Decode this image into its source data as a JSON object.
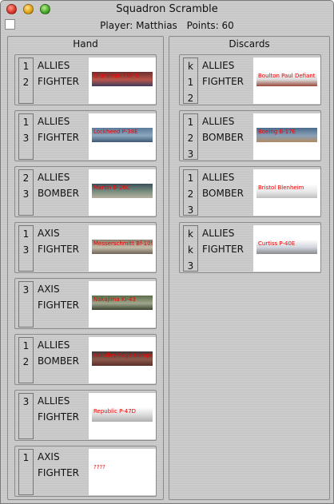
{
  "window": {
    "title": "Squadron Scramble"
  },
  "status": {
    "player": "Player: Matthias",
    "points": "Points: 60"
  },
  "hand": {
    "title": "Hand",
    "cards": [
      {
        "c1": "1",
        "c2": "2",
        "c3": "",
        "side": "ALLIES",
        "type": "FIGHTER",
        "plane": "Grumman F6F-5",
        "colors": [
          "#6b2e2e",
          "#b8544a",
          "#3c3c5c"
        ]
      },
      {
        "c1": "1",
        "c2": "3",
        "c3": "",
        "side": "ALLIES",
        "type": "FIGHTER",
        "plane": "Lockheed P-38E",
        "colors": [
          "#5b7a9a",
          "#8ba6bf",
          "#3e5872"
        ]
      },
      {
        "c1": "2",
        "c2": "3",
        "c3": "",
        "side": "ALLIES",
        "type": "BOMBER",
        "plane": "Martin B-26C",
        "colors": [
          "#3b4f5c",
          "#7b8f80",
          "#b8b0a0"
        ]
      },
      {
        "c1": "1",
        "c2": "3",
        "c3": "",
        "side": "AXIS",
        "type": "FIGHTER",
        "plane": "Messerschmitt Bf-109E",
        "colors": [
          "#8a8070",
          "#c4bba8",
          "#6e6456"
        ]
      },
      {
        "c1": "3",
        "c2": "",
        "c3": "",
        "side": "AXIS",
        "type": "FIGHTER",
        "plane": "Nakajima Ki-43",
        "colors": [
          "#5a6e4a",
          "#a0a68c",
          "#3a4430"
        ]
      },
      {
        "c1": "1",
        "c2": "2",
        "c3": "",
        "side": "ALLIES",
        "type": "BOMBER",
        "plane": "Handley Page Hampden",
        "colors": [
          "#3e3838",
          "#8c5a4a",
          "#5a2e2a"
        ]
      },
      {
        "c1": "3",
        "c2": "",
        "c3": "",
        "side": "ALLIES",
        "type": "FIGHTER",
        "plane": "Republic P-47D",
        "colors": [
          "#ffffff",
          "#d8d8d8",
          "#b0b0b0"
        ]
      },
      {
        "c1": "1",
        "c2": "",
        "c3": "",
        "side": "AXIS",
        "type": "FIGHTER",
        "plane": "????",
        "colors": [
          "#ffffff",
          "#ffffff",
          "#ffffff"
        ]
      }
    ]
  },
  "discards": {
    "title": "Discards",
    "cards": [
      {
        "c1": "k",
        "c2": "1",
        "c3": "2",
        "side": "ALLIES",
        "type": "FIGHTER",
        "plane": "Boulton Paul Defiant",
        "colors": [
          "#ffffff",
          "#d8d8d8",
          "#9a4a3a"
        ]
      },
      {
        "c1": "1",
        "c2": "2",
        "c3": "3",
        "side": "ALLIES",
        "type": "BOMBER",
        "plane": "Boeing B-17E",
        "colors": [
          "#4a6a8a",
          "#8aa0b8",
          "#b08a60"
        ]
      },
      {
        "c1": "1",
        "c2": "2",
        "c3": "3",
        "side": "ALLIES",
        "type": "BOMBER",
        "plane": "Bristol Blenheim",
        "colors": [
          "#ffffff",
          "#e8e8e8",
          "#c0c0c0"
        ]
      },
      {
        "c1": "k",
        "c2": "k",
        "c3": "3",
        "side": "ALLIES",
        "type": "FIGHTER",
        "plane": "Curtiss P-40E",
        "colors": [
          "#ffffff",
          "#d0d4dc",
          "#8a8a90"
        ]
      }
    ]
  }
}
